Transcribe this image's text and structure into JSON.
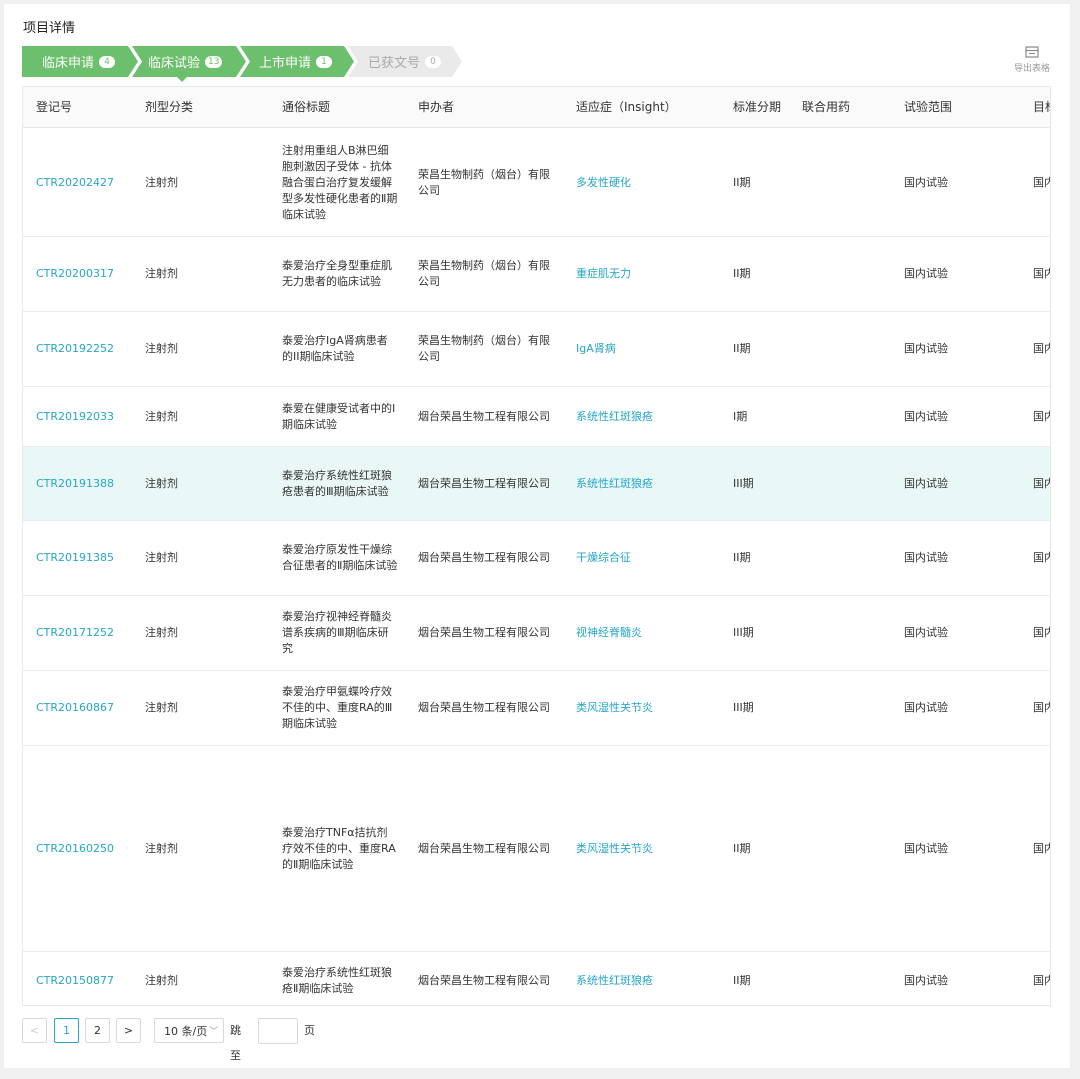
{
  "page_title": "项目详情",
  "steps": [
    {
      "label": "临床申请",
      "count": "4"
    },
    {
      "label": "临床试验",
      "count": "13"
    },
    {
      "label": "上市申请",
      "count": "1"
    },
    {
      "label": "已获文号",
      "count": "0"
    }
  ],
  "export_label": "导出表格",
  "columns": [
    "登记号",
    "剂型分类",
    "通俗标题",
    "申办者",
    "适应症（Insight）",
    "标准分期",
    "联合用药",
    "试验范围",
    "目标"
  ],
  "rows": [
    {
      "reg": "CTR20202427",
      "form": "注射剂",
      "title": "注射用重组人B淋巴细胞刺激因子受体 - 抗体融合蛋白治疗复发缓解型多发性硬化患者的Ⅱ期临床试验",
      "sponsor": "荣昌生物制药（烟台）有限公司",
      "indication": "多发性硬化",
      "phase": "II期",
      "combo": "",
      "scope": "国内试验",
      "target": "国内"
    },
    {
      "reg": "CTR20200317",
      "form": "注射剂",
      "title": "泰爱治疗全身型重症肌无力患者的临床试验",
      "sponsor": "荣昌生物制药（烟台）有限公司",
      "indication": "重症肌无力",
      "phase": "II期",
      "combo": "",
      "scope": "国内试验",
      "target": "国内"
    },
    {
      "reg": "CTR20192252",
      "form": "注射剂",
      "title": "泰爱治疗IgA肾病患者的II期临床试验",
      "sponsor": "荣昌生物制药（烟台）有限公司",
      "indication": "IgA肾病",
      "phase": "II期",
      "combo": "",
      "scope": "国内试验",
      "target": "国内"
    },
    {
      "reg": "CTR20192033",
      "form": "注射剂",
      "title": "泰爱在健康受试者中的I期临床试验",
      "sponsor": "烟台荣昌生物工程有限公司",
      "indication": "系统性红斑狼疮",
      "phase": "I期",
      "combo": "",
      "scope": "国内试验",
      "target": "国内"
    },
    {
      "reg": "CTR20191388",
      "form": "注射剂",
      "title": "泰爱治疗系统性红斑狼疮患者的Ⅲ期临床试验",
      "sponsor": "烟台荣昌生物工程有限公司",
      "indication": "系统性红斑狼疮",
      "phase": "III期",
      "combo": "",
      "scope": "国内试验",
      "target": "国内"
    },
    {
      "reg": "CTR20191385",
      "form": "注射剂",
      "title": "泰爱治疗原发性干燥综合征患者的Ⅱ期临床试验",
      "sponsor": "烟台荣昌生物工程有限公司",
      "indication": "干燥综合征",
      "phase": "II期",
      "combo": "",
      "scope": "国内试验",
      "target": "国内"
    },
    {
      "reg": "CTR20171252",
      "form": "注射剂",
      "title": "泰爱治疗视神经脊髓炎谱系疾病的Ⅲ期临床研究",
      "sponsor": "烟台荣昌生物工程有限公司",
      "indication": "视神经脊髓炎",
      "phase": "III期",
      "combo": "",
      "scope": "国内试验",
      "target": "国内"
    },
    {
      "reg": "CTR20160867",
      "form": "注射剂",
      "title": "泰爱治疗甲氨蝶呤疗效不佳的中、重度RA的Ⅲ期临床试验",
      "sponsor": "烟台荣昌生物工程有限公司",
      "indication": "类风湿性关节炎",
      "phase": "III期",
      "combo": "",
      "scope": "国内试验",
      "target": "国内"
    },
    {
      "reg": "CTR20160250",
      "form": "注射剂",
      "title": "泰爱治疗TNFα拮抗剂疗效不佳的中、重度RA的Ⅱ期临床试验",
      "sponsor": "烟台荣昌生物工程有限公司",
      "indication": "类风湿性关节炎",
      "phase": "II期",
      "combo": "",
      "scope": "国内试验",
      "target": "国内"
    },
    {
      "reg": "CTR20150877",
      "form": "注射剂",
      "title": "泰爱治疗系统性红斑狼疮Ⅱ期临床试验",
      "sponsor": "烟台荣昌生物工程有限公司",
      "indication": "系统性红斑狼疮",
      "phase": "II期",
      "combo": "",
      "scope": "国内试验",
      "target": "国内"
    }
  ],
  "pagination": {
    "prev": "<",
    "pages": [
      "1",
      "2"
    ],
    "next": ">",
    "page_size": "10 条/页",
    "jump_label": "跳至",
    "page_suffix": "页"
  }
}
